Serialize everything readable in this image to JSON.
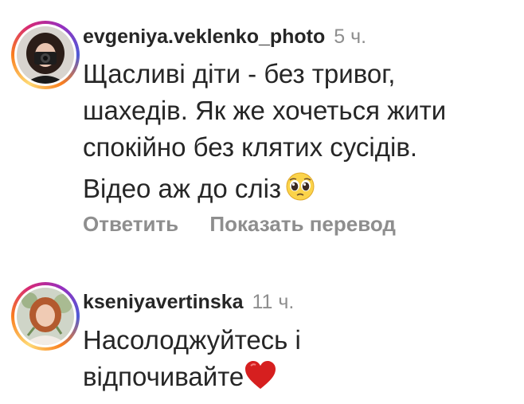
{
  "comments": [
    {
      "username": "evgeniya.veklenko_photo",
      "time": "5 ч.",
      "lines": [
        "Щасливі діти - без тривог,",
        "шахедів. Як же хочеться жити",
        "спокійно без клятих сусідів."
      ],
      "second_paragraph": "Відео аж до сліз",
      "emoji": "pleading-face-emoji",
      "actions": {
        "reply": "Ответить",
        "translate": "Показать перевод"
      }
    },
    {
      "username": "kseniyavertinska",
      "time": "11 ч.",
      "lines": [
        "Насолоджуйтесь і",
        "відпочивайте"
      ],
      "emoji": "red-heart-emoji"
    }
  ],
  "colors": {
    "text": "#262626",
    "secondary": "#8e8e8e",
    "story_ring": [
      "#feda75",
      "#fa7e1e",
      "#d62976",
      "#962fbf",
      "#4f5bd5"
    ]
  }
}
